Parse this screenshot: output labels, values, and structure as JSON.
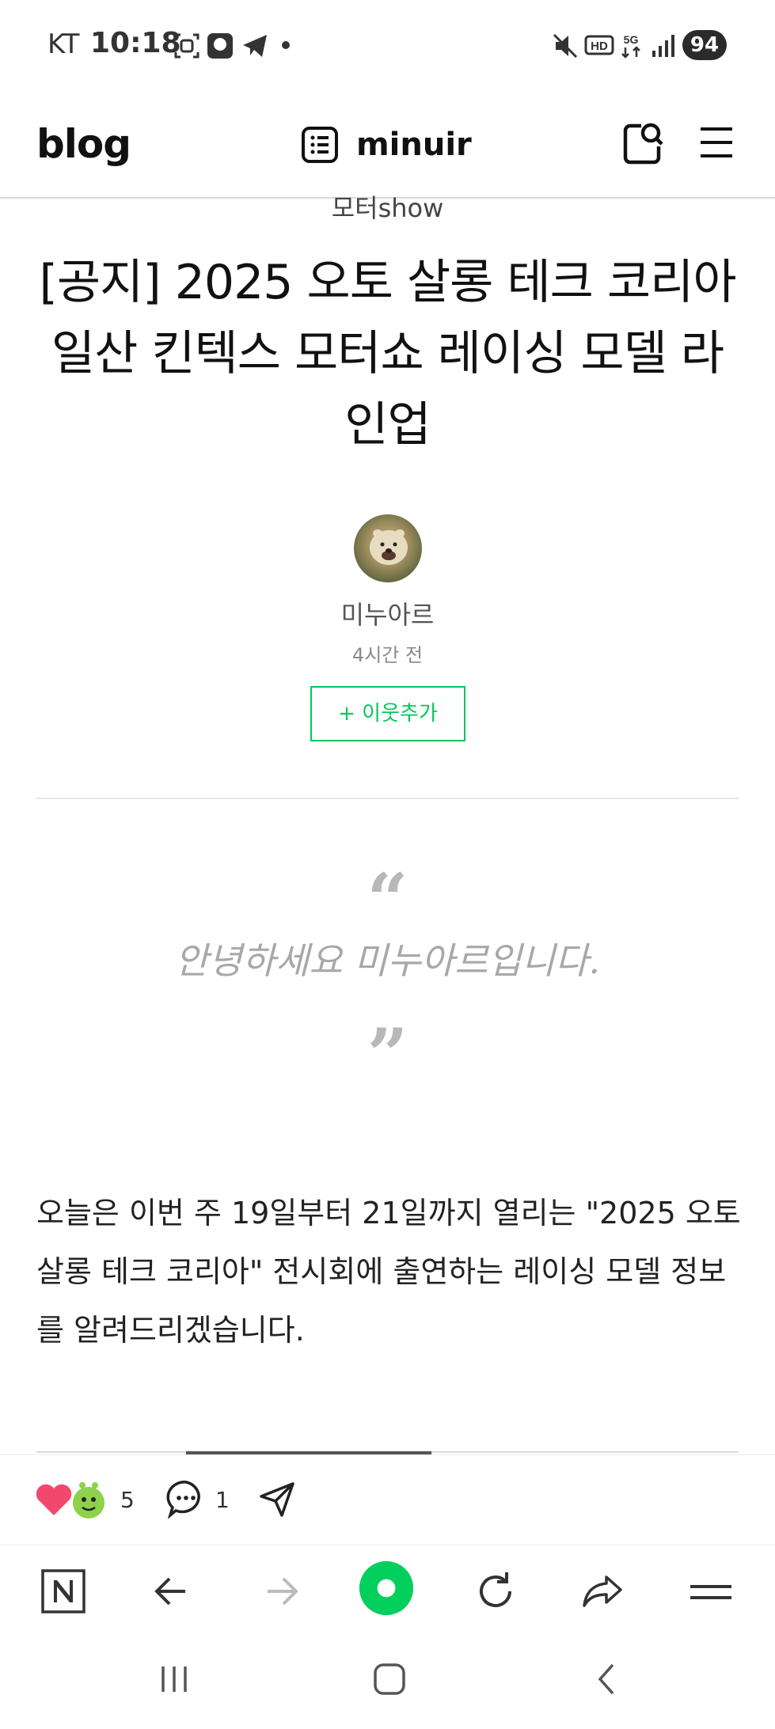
{
  "status_bar": {
    "carrier": "KT",
    "time": "10:18",
    "battery": "94",
    "network": "5G",
    "hd_label": "HD"
  },
  "header": {
    "logo": "blog",
    "blog_name": "minuir"
  },
  "post": {
    "category": "모터show",
    "title": "[공지] 2025 오토 살롱 테크 코리아 일산 킨텍스 모터쇼 레이싱 모델 라인업",
    "author": "미누아르",
    "time_ago": "4시간 전",
    "follow_label": "+ 이웃추가",
    "quote": "안녕하세요 미누아르입니다.",
    "body": "오늘은 이번 주 19일부터 21일까지 열리는 \"2025 오토 살롱 테크 코리아\" 전시회에 출연하는 레이싱 모델 정보를 알려드리겠습니다."
  },
  "reactions": {
    "like_count": "5",
    "comment_count": "1"
  },
  "colors": {
    "accent": "#03c75a",
    "heart": "#f2486e",
    "quote": "#a8a8a8"
  },
  "icons": {
    "header": [
      "list-icon",
      "search-icon",
      "menu-icon"
    ],
    "toolbar": [
      "naver-home-icon",
      "back-icon",
      "forward-icon",
      "green-dot-icon",
      "refresh-icon",
      "share-icon",
      "menu-icon"
    ],
    "navbar": [
      "recent-apps-icon",
      "home-icon",
      "back-icon"
    ]
  }
}
